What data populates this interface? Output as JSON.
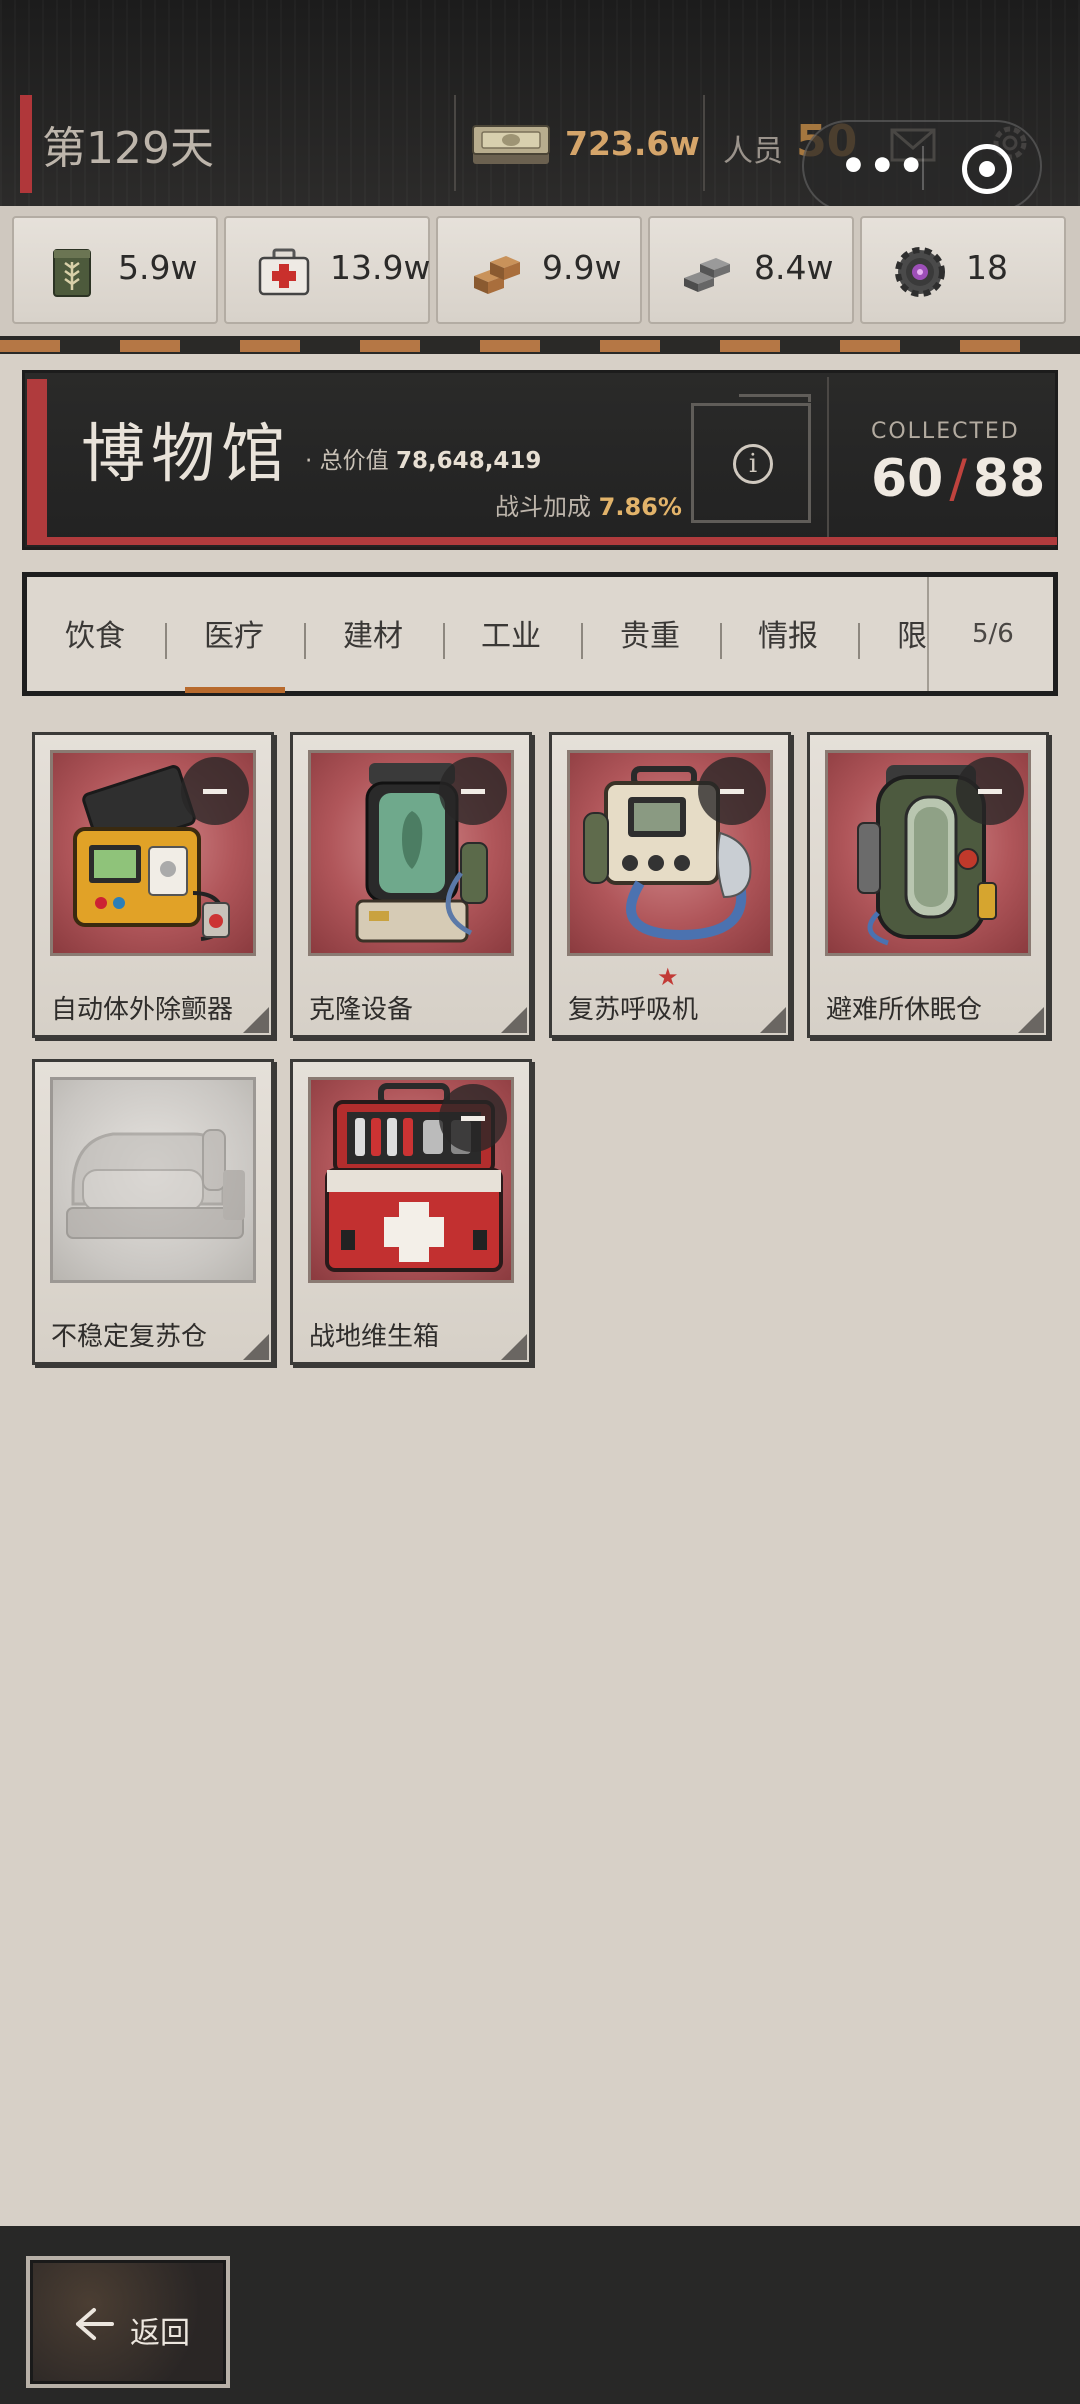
{
  "header": {
    "day": "第129天",
    "cash": "723.6w",
    "staff_label": "人员",
    "staff_value": "50",
    "miniprogram": {
      "more": "•••"
    }
  },
  "resources": [
    {
      "icon": "wheat-crate-icon",
      "value": "5.9w"
    },
    {
      "icon": "medkit-icon",
      "value": "13.9w"
    },
    {
      "icon": "wood-bricks-icon",
      "value": "9.9w"
    },
    {
      "icon": "steel-ingots-icon",
      "value": "8.4w"
    },
    {
      "icon": "gear-chip-icon",
      "value": "18"
    }
  ],
  "museum": {
    "title": "博物馆",
    "total_prefix": "· 总价值",
    "total_value": "78,648,419",
    "combat_label": "战斗加成",
    "combat_value": "7.86%",
    "info_glyph": "i",
    "collected_label": "COLLECTED",
    "collected": "60",
    "total": "88"
  },
  "tabs": {
    "items": [
      "饮食",
      "医疗",
      "建材",
      "工业",
      "贵重",
      "情报",
      "限"
    ],
    "active_index": 1,
    "page": "5/6"
  },
  "items": [
    {
      "name": "自动体外除颤器",
      "icon": "defibrillator-icon",
      "owned": true,
      "starred": false
    },
    {
      "name": "克隆设备",
      "icon": "clone-tank-icon",
      "owned": true,
      "starred": false
    },
    {
      "name": "复苏呼吸机",
      "icon": "ventilator-icon",
      "owned": true,
      "starred": true
    },
    {
      "name": "避难所休眠仓",
      "icon": "sleep-pod-icon",
      "owned": true,
      "starred": false
    },
    {
      "name": "不稳定复苏仓",
      "icon": "revival-bed-icon",
      "owned": false,
      "starred": false
    },
    {
      "name": "战地维生箱",
      "icon": "field-medkit-icon",
      "owned": true,
      "starred": false
    }
  ],
  "star_glyph": "★",
  "footer": {
    "back_label": "返回"
  },
  "colors": {
    "accent_red": "#b03b3d",
    "cash_gold": "#d5a56a",
    "bonus_gold": "#e2b36a",
    "tab_underline": "#b86a2d"
  }
}
